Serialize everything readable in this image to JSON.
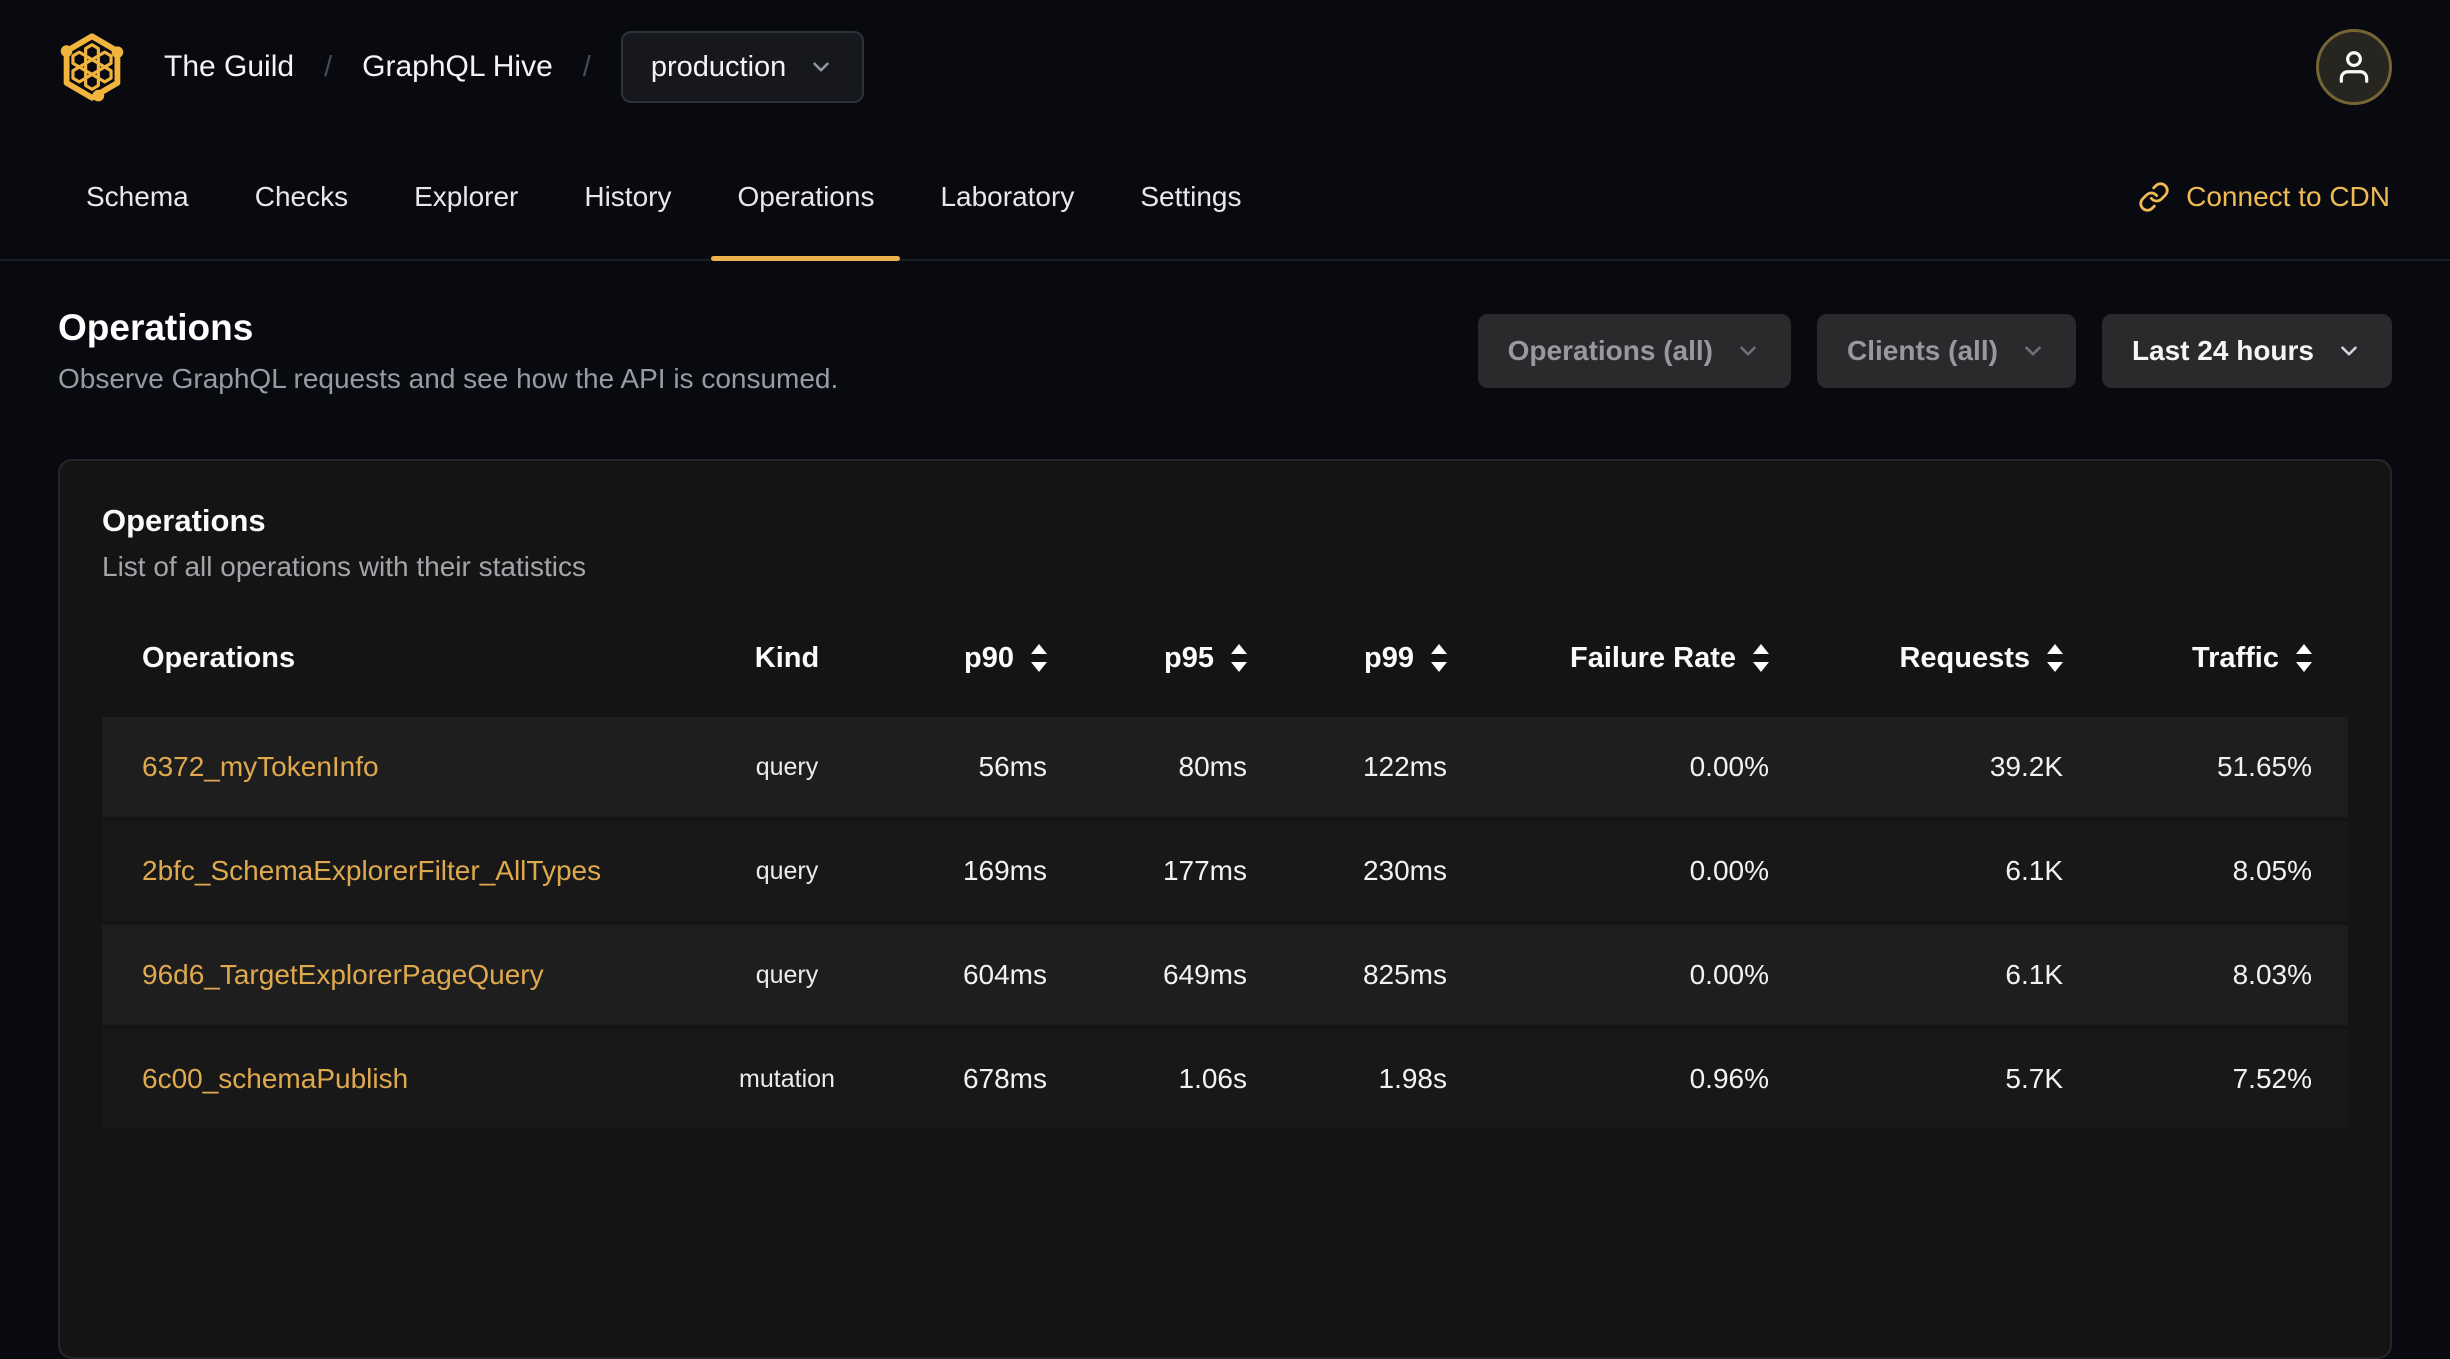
{
  "header": {
    "org": "The Guild",
    "separator": "/",
    "project": "GraphQL Hive",
    "target_selector": {
      "value": "production"
    }
  },
  "nav": {
    "tabs": [
      {
        "label": "Schema"
      },
      {
        "label": "Checks"
      },
      {
        "label": "Explorer"
      },
      {
        "label": "History"
      },
      {
        "label": "Operations",
        "active": true
      },
      {
        "label": "Laboratory"
      },
      {
        "label": "Settings"
      }
    ],
    "cdn_link_label": "Connect to CDN"
  },
  "page": {
    "title": "Operations",
    "subtitle": "Observe GraphQL requests and see how the API is consumed."
  },
  "filters": {
    "operations_label": "Operations (all)",
    "clients_label": "Clients (all)",
    "period_label": "Last 24 hours"
  },
  "card": {
    "title": "Operations",
    "subtitle": "List of all operations with their statistics"
  },
  "table": {
    "columns": [
      {
        "label": "Operations",
        "sortable": false
      },
      {
        "label": "Kind",
        "sortable": false
      },
      {
        "label": "p90",
        "sortable": true
      },
      {
        "label": "p95",
        "sortable": true
      },
      {
        "label": "p99",
        "sortable": true
      },
      {
        "label": "Failure Rate",
        "sortable": true
      },
      {
        "label": "Requests",
        "sortable": true
      },
      {
        "label": "Traffic",
        "sortable": true
      }
    ],
    "rows": [
      {
        "name": "6372_myTokenInfo",
        "kind": "query",
        "p90": "56ms",
        "p95": "80ms",
        "p99": "122ms",
        "failure_rate": "0.00%",
        "requests": "39.2K",
        "traffic": "51.65%"
      },
      {
        "name": "2bfc_SchemaExplorerFilter_AllTypes",
        "kind": "query",
        "p90": "169ms",
        "p95": "177ms",
        "p99": "230ms",
        "failure_rate": "0.00%",
        "requests": "6.1K",
        "traffic": "8.05%"
      },
      {
        "name": "96d6_TargetExplorerPageQuery",
        "kind": "query",
        "p90": "604ms",
        "p95": "649ms",
        "p99": "825ms",
        "failure_rate": "0.00%",
        "requests": "6.1K",
        "traffic": "8.03%"
      },
      {
        "name": "6c00_schemaPublish",
        "kind": "mutation",
        "p90": "678ms",
        "p95": "1.06s",
        "p99": "1.98s",
        "failure_rate": "0.96%",
        "requests": "5.7K",
        "traffic": "7.52%"
      }
    ]
  },
  "icons": {
    "logo": "guild-honeycomb-logo",
    "breadcrumb_dropdown": "chevron-down-icon",
    "cdn": "link-chain-icon",
    "avatar": "user-person-icon",
    "sort": "sort-up-down-arrows"
  },
  "colors": {
    "page_background": "#080a0f",
    "card_background": "#141414",
    "row_odd": "#1e1e1e",
    "row_even": "#181818",
    "accent_brand": "#eeb14b",
    "link_amber": "#dfa94e",
    "muted_text": "#979ca3"
  }
}
